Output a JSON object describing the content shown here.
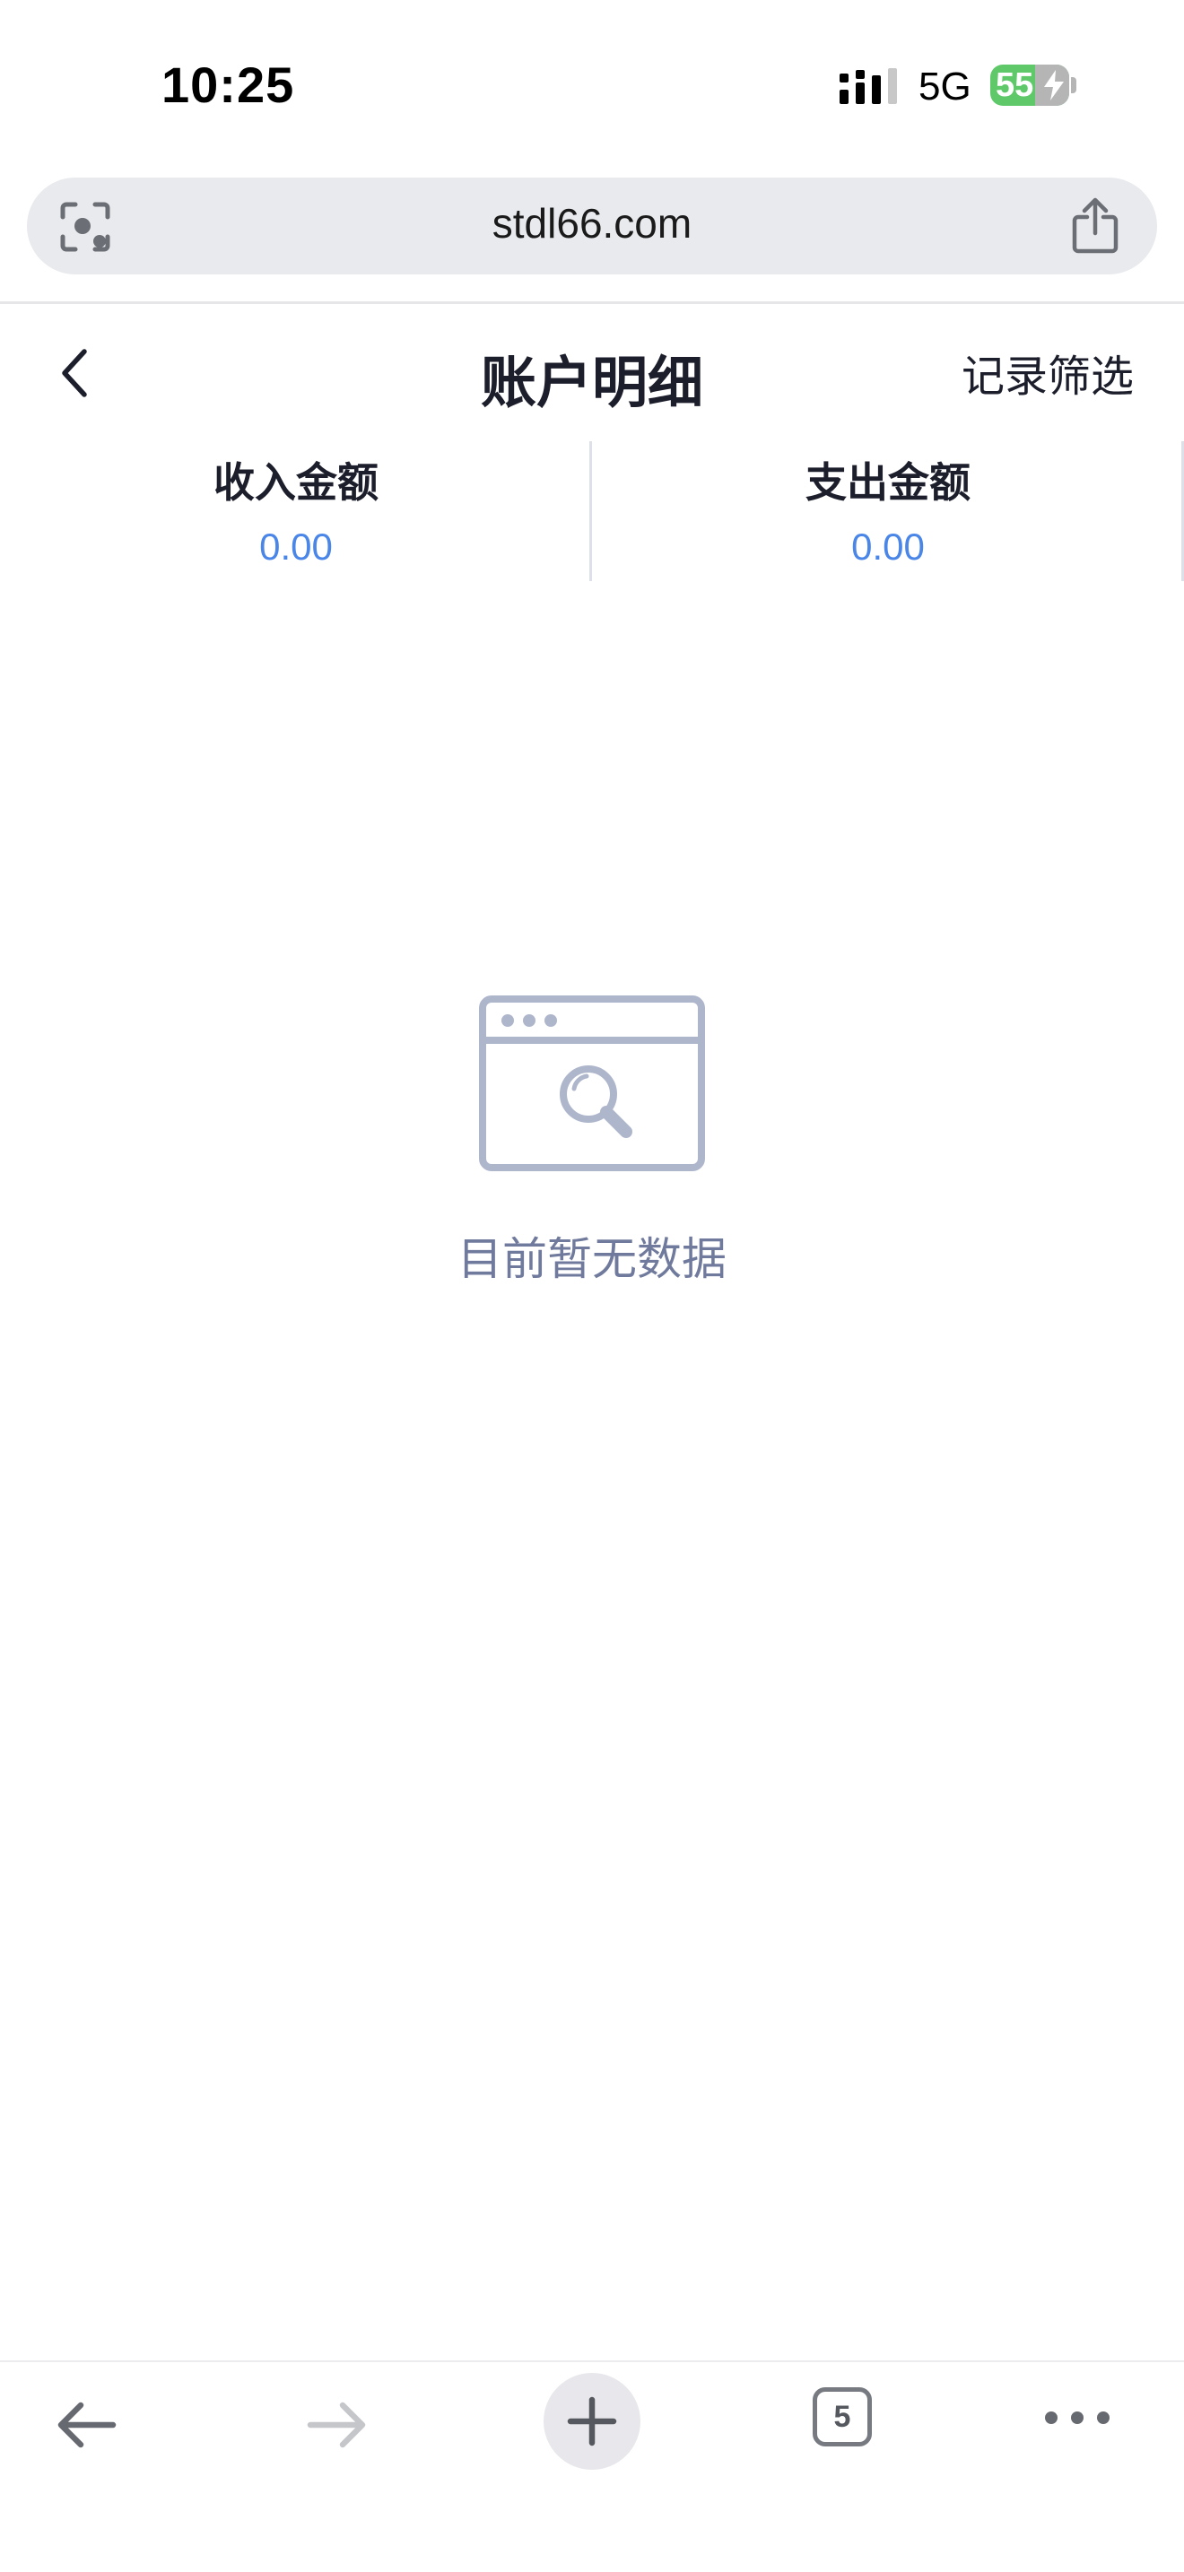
{
  "status_bar": {
    "time": "10:25",
    "network": "5G",
    "battery": "55"
  },
  "browser": {
    "url": "stdl66.com",
    "open_tabs": "5"
  },
  "header": {
    "title": "账户明细",
    "filter_label": "记录筛选"
  },
  "summary": {
    "income_label": "收入金额",
    "income_value": "0.00",
    "expense_label": "支出金额",
    "expense_value": "0.00"
  },
  "empty_state": {
    "message": "目前暂无数据"
  },
  "colors": {
    "accent": "#4a86e8",
    "empty_text": "#6f7a9c",
    "empty_icon": "#aeb6cc",
    "battery": "#5fc96a"
  }
}
